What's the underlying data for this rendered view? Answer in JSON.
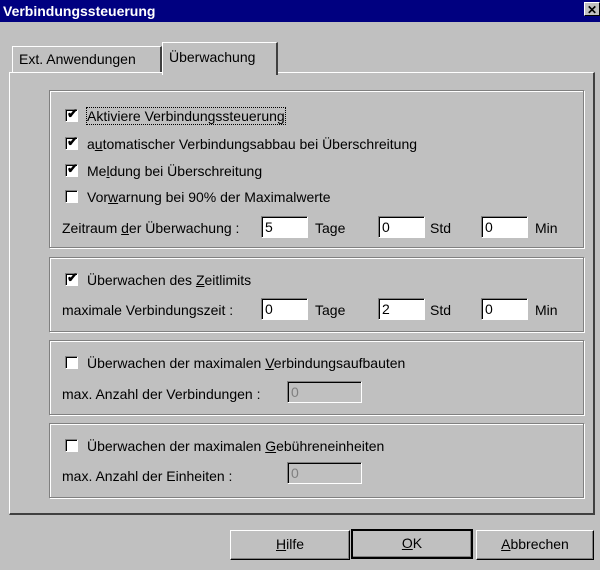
{
  "window": {
    "title": "Verbindungssteuerung",
    "close_glyph": "✕"
  },
  "tabs": [
    {
      "label": "Ext. Anwendungen"
    },
    {
      "label": "Überwachung"
    }
  ],
  "group1": {
    "cb_activate": {
      "label": "Aktiviere Verbindungssteuerung",
      "checked": true
    },
    "cb_auto_disconnect": {
      "label_pre": "a",
      "label_u": "u",
      "label_post": "tomatischer Verbindungsabbau bei Überschreitung",
      "checked": true
    },
    "cb_message": {
      "label_pre": "Me",
      "label_u": "l",
      "label_post": "dung bei Überschreitung",
      "checked": true
    },
    "cb_warning": {
      "label_pre": "Vor",
      "label_u": "w",
      "label_post": "arnung bei 90% der Maximalwerte",
      "checked": false
    },
    "period_label_pre": "Zeitraum ",
    "period_label_u": "d",
    "period_label_post": "er Überwachung :",
    "period_days": "5",
    "period_hours": "0",
    "period_minutes": "0",
    "unit_days": "Tage",
    "unit_hours": "Std",
    "unit_minutes": "Min"
  },
  "group2": {
    "cb_timelimit": {
      "label_pre": "Überwachen des ",
      "label_u": "Z",
      "label_post": "eitlimits",
      "checked": true
    },
    "max_time_label": "maximale Verbindungszeit :",
    "max_days": "0",
    "max_hours": "2",
    "max_minutes": "0",
    "unit_days": "Tage",
    "unit_hours": "Std",
    "unit_minutes": "Min"
  },
  "group3": {
    "cb_connections": {
      "label_pre": "Überwachen der maximalen ",
      "label_u": "V",
      "label_post": "erbindungsaufbauten",
      "checked": false
    },
    "count_label": "max. Anzahl der Verbindungen :",
    "count_value": "0"
  },
  "group4": {
    "cb_units": {
      "label_pre": "Überwachen der maximalen ",
      "label_u": "G",
      "label_post": "ebühreneinheiten",
      "checked": false
    },
    "count_label": "max. Anzahl der Einheiten :",
    "count_value": "0"
  },
  "buttons": {
    "help": {
      "u": "H",
      "rest": "ilfe"
    },
    "ok": {
      "u": "O",
      "rest": "K"
    },
    "cancel": {
      "u": "A",
      "rest": "bbrechen"
    }
  },
  "check_glyph": "✔"
}
